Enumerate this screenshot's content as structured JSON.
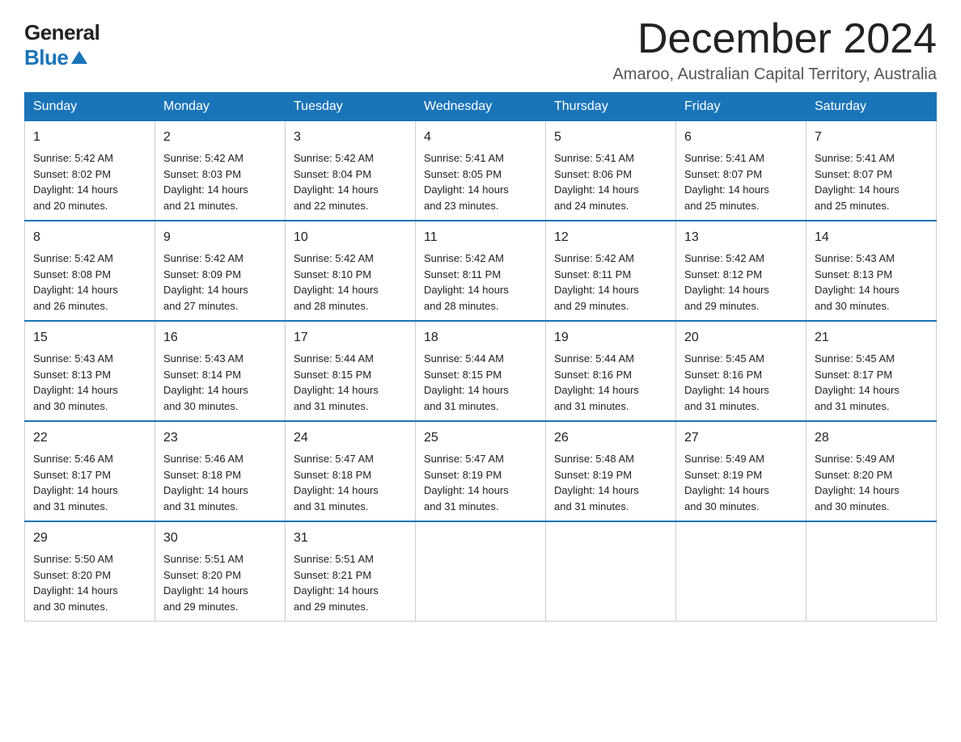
{
  "logo": {
    "general": "General",
    "blue": "Blue"
  },
  "title": "December 2024",
  "location": "Amaroo, Australian Capital Territory, Australia",
  "weekdays": [
    "Sunday",
    "Monday",
    "Tuesday",
    "Wednesday",
    "Thursday",
    "Friday",
    "Saturday"
  ],
  "weeks": [
    [
      {
        "day": "1",
        "sunrise": "5:42 AM",
        "sunset": "8:02 PM",
        "daylight": "14 hours and 20 minutes."
      },
      {
        "day": "2",
        "sunrise": "5:42 AM",
        "sunset": "8:03 PM",
        "daylight": "14 hours and 21 minutes."
      },
      {
        "day": "3",
        "sunrise": "5:42 AM",
        "sunset": "8:04 PM",
        "daylight": "14 hours and 22 minutes."
      },
      {
        "day": "4",
        "sunrise": "5:41 AM",
        "sunset": "8:05 PM",
        "daylight": "14 hours and 23 minutes."
      },
      {
        "day": "5",
        "sunrise": "5:41 AM",
        "sunset": "8:06 PM",
        "daylight": "14 hours and 24 minutes."
      },
      {
        "day": "6",
        "sunrise": "5:41 AM",
        "sunset": "8:07 PM",
        "daylight": "14 hours and 25 minutes."
      },
      {
        "day": "7",
        "sunrise": "5:41 AM",
        "sunset": "8:07 PM",
        "daylight": "14 hours and 25 minutes."
      }
    ],
    [
      {
        "day": "8",
        "sunrise": "5:42 AM",
        "sunset": "8:08 PM",
        "daylight": "14 hours and 26 minutes."
      },
      {
        "day": "9",
        "sunrise": "5:42 AM",
        "sunset": "8:09 PM",
        "daylight": "14 hours and 27 minutes."
      },
      {
        "day": "10",
        "sunrise": "5:42 AM",
        "sunset": "8:10 PM",
        "daylight": "14 hours and 28 minutes."
      },
      {
        "day": "11",
        "sunrise": "5:42 AM",
        "sunset": "8:11 PM",
        "daylight": "14 hours and 28 minutes."
      },
      {
        "day": "12",
        "sunrise": "5:42 AM",
        "sunset": "8:11 PM",
        "daylight": "14 hours and 29 minutes."
      },
      {
        "day": "13",
        "sunrise": "5:42 AM",
        "sunset": "8:12 PM",
        "daylight": "14 hours and 29 minutes."
      },
      {
        "day": "14",
        "sunrise": "5:43 AM",
        "sunset": "8:13 PM",
        "daylight": "14 hours and 30 minutes."
      }
    ],
    [
      {
        "day": "15",
        "sunrise": "5:43 AM",
        "sunset": "8:13 PM",
        "daylight": "14 hours and 30 minutes."
      },
      {
        "day": "16",
        "sunrise": "5:43 AM",
        "sunset": "8:14 PM",
        "daylight": "14 hours and 30 minutes."
      },
      {
        "day": "17",
        "sunrise": "5:44 AM",
        "sunset": "8:15 PM",
        "daylight": "14 hours and 31 minutes."
      },
      {
        "day": "18",
        "sunrise": "5:44 AM",
        "sunset": "8:15 PM",
        "daylight": "14 hours and 31 minutes."
      },
      {
        "day": "19",
        "sunrise": "5:44 AM",
        "sunset": "8:16 PM",
        "daylight": "14 hours and 31 minutes."
      },
      {
        "day": "20",
        "sunrise": "5:45 AM",
        "sunset": "8:16 PM",
        "daylight": "14 hours and 31 minutes."
      },
      {
        "day": "21",
        "sunrise": "5:45 AM",
        "sunset": "8:17 PM",
        "daylight": "14 hours and 31 minutes."
      }
    ],
    [
      {
        "day": "22",
        "sunrise": "5:46 AM",
        "sunset": "8:17 PM",
        "daylight": "14 hours and 31 minutes."
      },
      {
        "day": "23",
        "sunrise": "5:46 AM",
        "sunset": "8:18 PM",
        "daylight": "14 hours and 31 minutes."
      },
      {
        "day": "24",
        "sunrise": "5:47 AM",
        "sunset": "8:18 PM",
        "daylight": "14 hours and 31 minutes."
      },
      {
        "day": "25",
        "sunrise": "5:47 AM",
        "sunset": "8:19 PM",
        "daylight": "14 hours and 31 minutes."
      },
      {
        "day": "26",
        "sunrise": "5:48 AM",
        "sunset": "8:19 PM",
        "daylight": "14 hours and 31 minutes."
      },
      {
        "day": "27",
        "sunrise": "5:49 AM",
        "sunset": "8:19 PM",
        "daylight": "14 hours and 30 minutes."
      },
      {
        "day": "28",
        "sunrise": "5:49 AM",
        "sunset": "8:20 PM",
        "daylight": "14 hours and 30 minutes."
      }
    ],
    [
      {
        "day": "29",
        "sunrise": "5:50 AM",
        "sunset": "8:20 PM",
        "daylight": "14 hours and 30 minutes."
      },
      {
        "day": "30",
        "sunrise": "5:51 AM",
        "sunset": "8:20 PM",
        "daylight": "14 hours and 29 minutes."
      },
      {
        "day": "31",
        "sunrise": "5:51 AM",
        "sunset": "8:21 PM",
        "daylight": "14 hours and 29 minutes."
      },
      null,
      null,
      null,
      null
    ]
  ],
  "labels": {
    "sunrise": "Sunrise:",
    "sunset": "Sunset:",
    "daylight": "Daylight:"
  }
}
